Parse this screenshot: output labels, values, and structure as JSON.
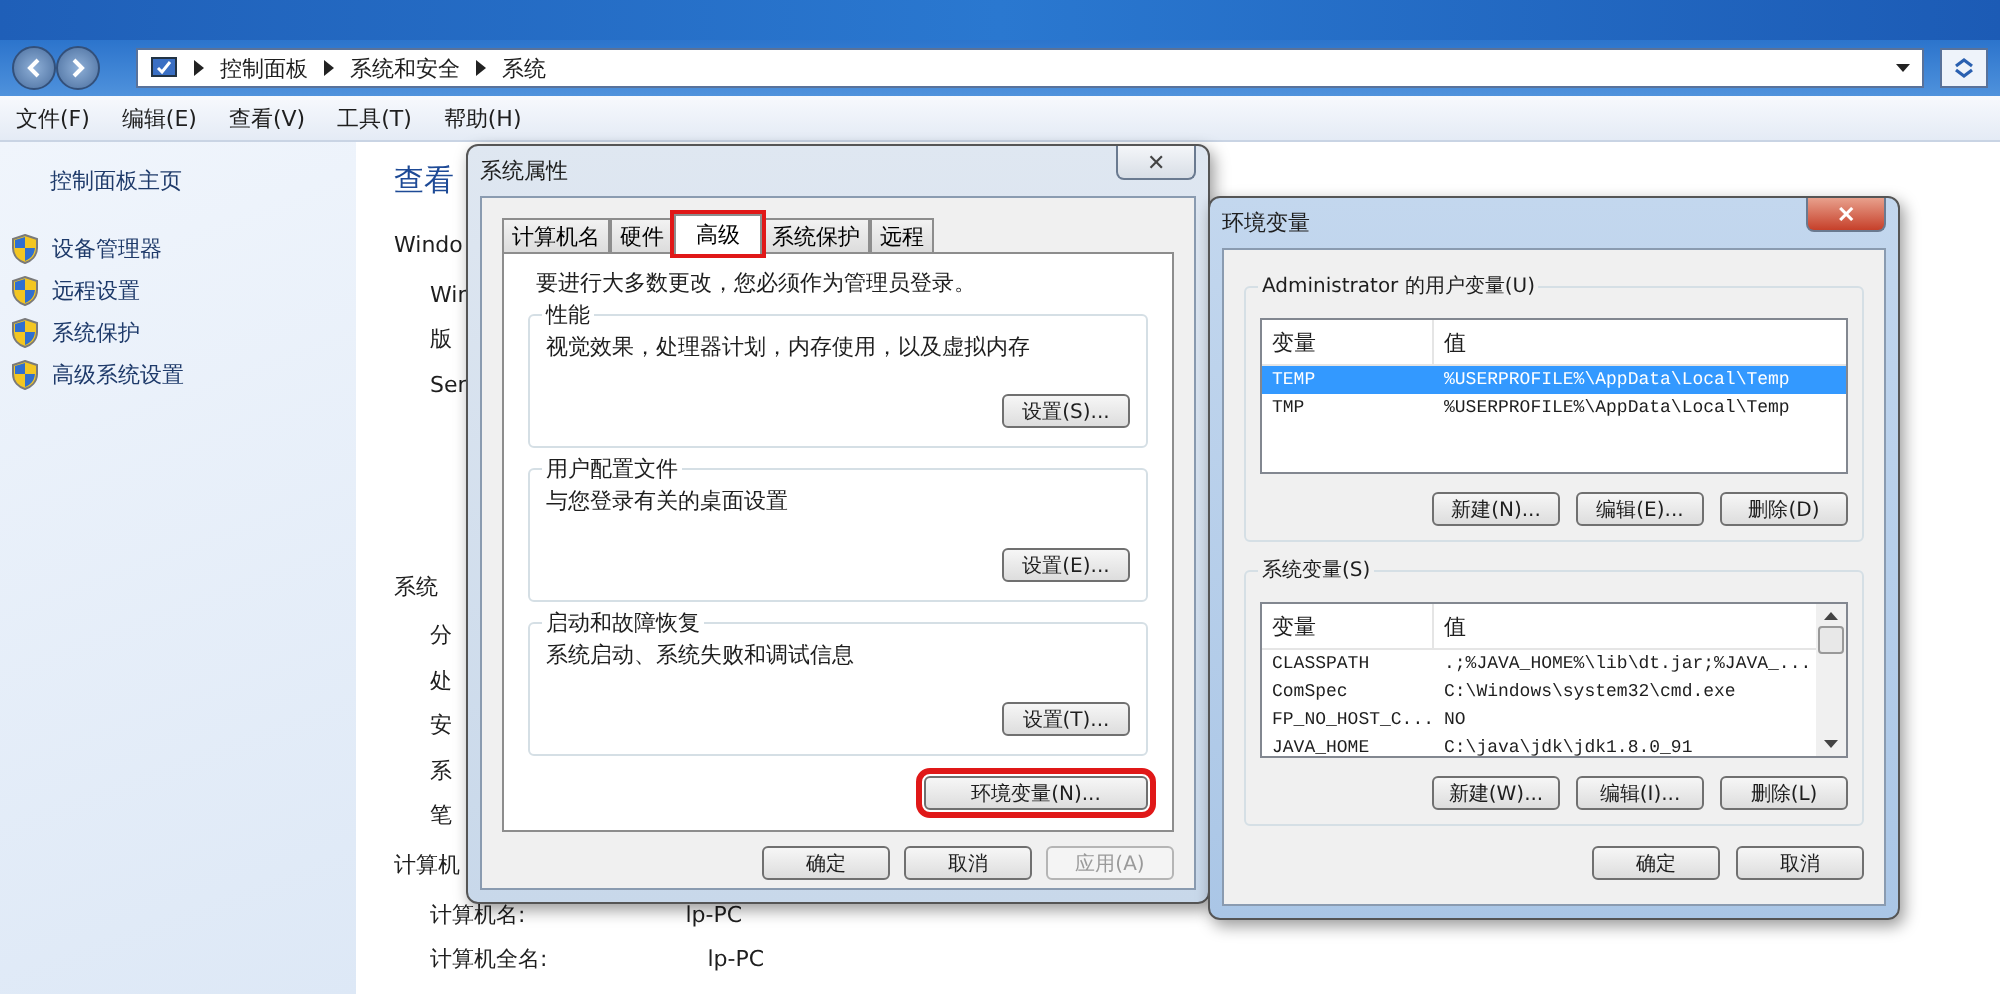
{
  "explorer": {
    "breadcrumb": [
      "控制面板",
      "系统和安全",
      "系统"
    ],
    "menu": [
      "文件(F)",
      "编辑(E)",
      "查看(V)",
      "工具(T)",
      "帮助(H)"
    ],
    "sidebar": {
      "home": "控制面板主页",
      "items": [
        {
          "label": "设备管理器"
        },
        {
          "label": "远程设置"
        },
        {
          "label": "系统保护"
        },
        {
          "label": "高级系统设置"
        }
      ]
    },
    "main": {
      "heading": "查看",
      "rows": [
        {
          "kind": "section",
          "label": "Windo"
        },
        {
          "kind": "item",
          "label": "Win"
        },
        {
          "kind": "item",
          "label": "版"
        },
        {
          "kind": "item",
          "label": "Ser"
        },
        {
          "kind": "gap"
        },
        {
          "kind": "section",
          "label": "系统"
        },
        {
          "kind": "item",
          "label": "分"
        },
        {
          "kind": "item",
          "label": "处"
        },
        {
          "kind": "item",
          "label": "安"
        },
        {
          "kind": "item",
          "label": "系"
        },
        {
          "kind": "item",
          "label": "笔"
        },
        {
          "kind": "section",
          "label": "计算机"
        },
        {
          "kind": "item",
          "label": "计算机名:",
          "value": "lp-PC"
        },
        {
          "kind": "item",
          "label": "计算机全名:",
          "value": "lp-PC"
        }
      ]
    }
  },
  "system_properties": {
    "title": "系统属性",
    "close": "✕",
    "tabs": [
      {
        "label": "计算机名",
        "selected": false,
        "highlighted": false
      },
      {
        "label": "硬件",
        "selected": false,
        "highlighted": false
      },
      {
        "label": "高级",
        "selected": true,
        "highlighted": true
      },
      {
        "label": "系统保护",
        "selected": false,
        "highlighted": false
      },
      {
        "label": "远程",
        "selected": false,
        "highlighted": false
      }
    ],
    "notice": "要进行大多数更改，您必须作为管理员登录。",
    "groups": [
      {
        "title": "性能",
        "text": "视觉效果，处理器计划，内存使用，以及虚拟内存",
        "button": "设置(S)..."
      },
      {
        "title": "用户配置文件",
        "text": "与您登录有关的桌面设置",
        "button": "设置(E)..."
      },
      {
        "title": "启动和故障恢复",
        "text": "系统启动、系统失败和调试信息",
        "button": "设置(T)..."
      }
    ],
    "env_button": {
      "label": "环境变量(N)...",
      "highlighted": true
    },
    "buttons": [
      {
        "label": "确定",
        "disabled": false
      },
      {
        "label": "取消",
        "disabled": false
      },
      {
        "label": "应用(A)",
        "disabled": true
      }
    ]
  },
  "environment_variables": {
    "title": "环境变量",
    "close": "✕",
    "sections": [
      {
        "title": "Administrator 的用户变量(U)",
        "columns": [
          "变量",
          "值"
        ],
        "scrollbar": false,
        "rows": [
          {
            "name": "TEMP",
            "value": "%USERPROFILE%\\AppData\\Local\\Temp",
            "selected": true
          },
          {
            "name": "TMP",
            "value": "%USERPROFILE%\\AppData\\Local\\Temp",
            "selected": false
          }
        ],
        "buttons": [
          "新建(N)...",
          "编辑(E)...",
          "删除(D)"
        ]
      },
      {
        "title": "系统变量(S)",
        "columns": [
          "变量",
          "值"
        ],
        "scrollbar": true,
        "rows": [
          {
            "name": "CLASSPATH",
            "value": ".;%JAVA_HOME%\\lib\\dt.jar;%JAVA_...",
            "selected": false
          },
          {
            "name": "ComSpec",
            "value": "C:\\Windows\\system32\\cmd.exe",
            "selected": false
          },
          {
            "name": "FP_NO_HOST_C...",
            "value": "NO",
            "selected": false
          },
          {
            "name": "JAVA_HOME",
            "value": "C:\\java\\jdk\\jdk1.8.0_91",
            "selected": false
          }
        ],
        "buttons": [
          "新建(W)...",
          "编辑(I)...",
          "删除(L)"
        ]
      }
    ],
    "buttons": [
      "确定",
      "取消"
    ]
  }
}
